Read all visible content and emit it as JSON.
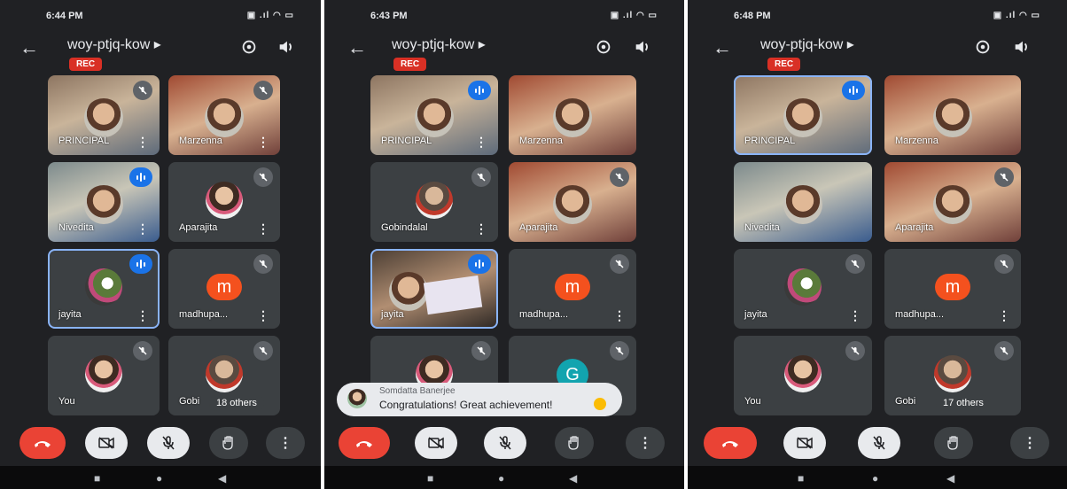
{
  "screens": [
    {
      "time": "6:44 PM",
      "meeting_code": "woy-ptjq-kow",
      "rec": "REC",
      "participants": [
        "PRINCIPAL",
        "Marzenna",
        "Nivedita",
        "Aparajita",
        "jayita",
        "madhupa...",
        "You",
        "Gobi"
      ],
      "others": "18 others"
    },
    {
      "time": "6:43 PM",
      "meeting_code": "woy-ptjq-kow",
      "rec": "REC",
      "participants": [
        "PRINCIPAL",
        "Marzenna",
        "Gobindalal",
        "Aparajita",
        "jayita",
        "madhupa...",
        "G"
      ],
      "toast": {
        "sender": "Somdatta Banerjee",
        "message": "Congratulations! Great achievement!"
      }
    },
    {
      "time": "6:48 PM",
      "meeting_code": "woy-ptjq-kow",
      "rec": "REC",
      "participants": [
        "PRINCIPAL",
        "Marzenna",
        "Nivedita",
        "Aparajita",
        "jayita",
        "madhupa...",
        "You",
        "Gobi"
      ],
      "others": "17 others"
    }
  ],
  "avatar_letters": {
    "m": "m",
    "g": "G"
  },
  "colors": {
    "end_call": "#ea4335",
    "active_speaker": "#1a73e8",
    "rec": "#d93025",
    "avatar_m": "#f4511e",
    "avatar_g": "#12a4af"
  }
}
